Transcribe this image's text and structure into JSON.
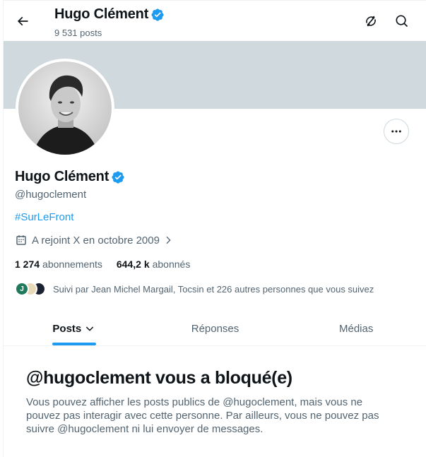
{
  "header": {
    "name": "Hugo Clément",
    "posts_count": "9 531 posts"
  },
  "profile": {
    "name": "Hugo Clément",
    "handle": "@hugoclement",
    "bio_hashtag": "#SurLeFront",
    "joined": "A rejoint X en octobre 2009",
    "following_count": "1 274",
    "following_label": "abonnements",
    "followers_count": "644,2 k",
    "followers_label": "abonnés",
    "followed_by": "Suivi par Jean Michel Margail, Tocsin et 226 autres personnes que vous suivez",
    "followed_by_avatar_1_initial": "J"
  },
  "tabs": [
    {
      "label": "Posts"
    },
    {
      "label": "Réponses"
    },
    {
      "label": "Médias"
    }
  ],
  "blocked_notice": {
    "title": "@hugoclement vous a bloqué(e)",
    "body": "Vous pouvez afficher les posts publics de @hugoclement, mais vous ne pouvez pas interagir avec cette personne. Par ailleurs, vous ne pouvez pas suivre @hugoclement ni lui envoyer de messages."
  },
  "icons": {
    "back": "arrow-left-icon",
    "translate": "translate-icon",
    "search": "search-icon",
    "more": "more-horizontal-icon",
    "verified": "verified-badge-icon",
    "calendar": "calendar-icon",
    "chevron": "chevron-right-icon",
    "dropdown": "chevron-down-icon"
  },
  "colors": {
    "accent": "#1d9bf0",
    "banner": "#cfd9de",
    "secondary_text": "#536471"
  }
}
